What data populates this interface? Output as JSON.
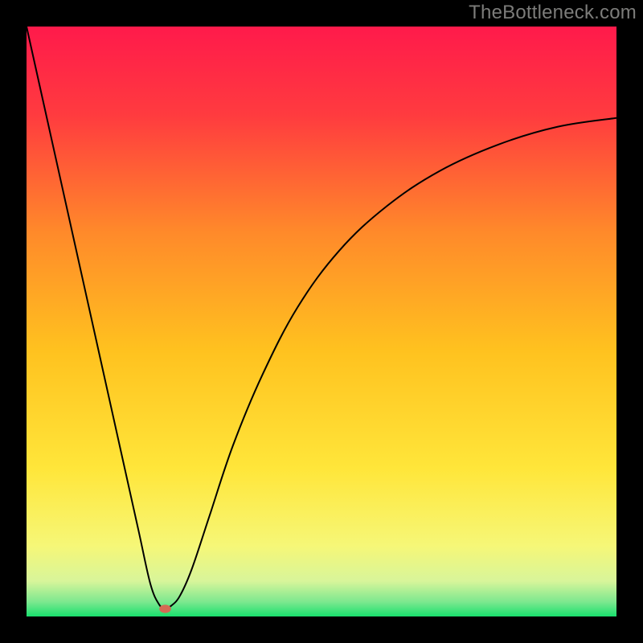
{
  "watermark": "TheBottleneck.com",
  "chart_data": {
    "type": "line",
    "title": "",
    "xlabel": "",
    "ylabel": "",
    "xlim": [
      0,
      100
    ],
    "ylim": [
      0,
      100
    ],
    "background_gradient": {
      "stops": [
        {
          "offset": 0.0,
          "color": "#ff1a4b"
        },
        {
          "offset": 0.15,
          "color": "#ff3b3f"
        },
        {
          "offset": 0.35,
          "color": "#ff8a2a"
        },
        {
          "offset": 0.55,
          "color": "#ffc21f"
        },
        {
          "offset": 0.75,
          "color": "#ffe63a"
        },
        {
          "offset": 0.88,
          "color": "#f6f777"
        },
        {
          "offset": 0.94,
          "color": "#d8f59a"
        },
        {
          "offset": 0.975,
          "color": "#7de88f"
        },
        {
          "offset": 1.0,
          "color": "#19e06e"
        }
      ]
    },
    "series": [
      {
        "name": "bottleneck-curve",
        "stroke": "#000000",
        "stroke_width": 2,
        "x": [
          0.0,
          4.0,
          8.0,
          12.0,
          16.0,
          19.0,
          21.0,
          22.5,
          23.5,
          24.5,
          26.0,
          28.0,
          31.0,
          35.0,
          40.0,
          46.0,
          53.0,
          61.0,
          70.0,
          80.0,
          90.0,
          100.0
        ],
        "y": [
          100.0,
          82.0,
          64.0,
          46.0,
          28.0,
          14.5,
          5.5,
          2.0,
          1.5,
          1.8,
          3.5,
          8.0,
          17.0,
          29.0,
          41.0,
          52.5,
          62.0,
          69.5,
          75.5,
          80.0,
          83.0,
          84.5
        ]
      }
    ],
    "marker": {
      "name": "optimal-point",
      "x": 23.5,
      "y": 1.3,
      "rx": 1.0,
      "ry": 0.7,
      "color": "#d46a54"
    }
  }
}
